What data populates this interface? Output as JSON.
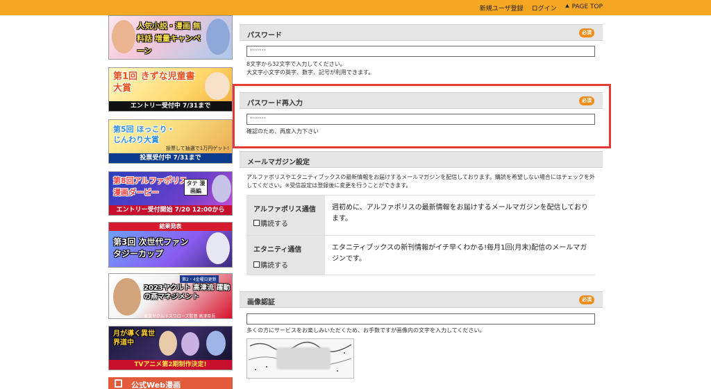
{
  "topbar": {
    "register": "新規ユーザ登録",
    "login": "ログイン",
    "pagetop": "PAGE TOP"
  },
  "banners": [
    {
      "title": "人気小説・漫画 無料話 増量キャンペーン"
    },
    {
      "title": "第1回 きずな児童書大賞",
      "strip": "エントリー受付中 7/31まで"
    },
    {
      "title": "第5回 ほっこり・じんわり大賞",
      "sub": "投票して抽選で1万円ゲット!",
      "strip": "投票受付中 7/31まで"
    },
    {
      "title": "第8回アルファポリス 漫画ダービー",
      "tag": "タテ 漫画編",
      "strip": "エントリー受付開始 7/20 12:00から"
    },
    {
      "head": "結果発表",
      "title": "第3回 次世代ファンタジーカップ"
    },
    {
      "title": "2023ヤクルト 高津流 躍動の燕マネジメント",
      "sub": "東京ヤクルトスワローズ監督 高津臣吾",
      "tag": "第2・4金曜日更新"
    },
    {
      "title": "月が導く異世界道中",
      "strip": "TVアニメ第2期制作決定!"
    },
    {
      "title": "公式Web漫画"
    }
  ],
  "password": {
    "label": "パスワード",
    "required": "必須",
    "value": "········",
    "note1": "8文字から32文字で入力してください。",
    "note2": "大文字小文字の英字、数字、記号が利用できます。"
  },
  "password_confirm": {
    "label": "パスワード再入力",
    "required": "必須",
    "value": "········",
    "note": "確認のため、再度入力下さい"
  },
  "magazine": {
    "label": "メールマガジン設定",
    "desc": "アルファポリスやエタニティブックスの最新情報をお届けするメールマガジンを配信しております。購読を希望しない場合にはチェックを外してください。※受信設定は登録後に変更を行うことができます。",
    "rows": [
      {
        "name": "アルファポリス通信",
        "subscribe": "購読する",
        "desc": "週初めに、アルファポリスの最新情報をお届けするメールマガジンを配信しております。"
      },
      {
        "name": "エタニティ通信",
        "subscribe": "購読する",
        "desc": "エタニティブックスの新刊情報がイチ早くわかる!毎月1回(月末)配信のメールマガジンです。"
      }
    ]
  },
  "captcha": {
    "label": "画像認証",
    "required": "必須",
    "value": "",
    "note": "多くの方にサービスをお楽しみいただくため、お手数ですが画像内の文字を入力してください。"
  },
  "colors": {
    "accent": "#f5a623",
    "required_badge": "#f08c1a",
    "highlight": "#e53935"
  }
}
